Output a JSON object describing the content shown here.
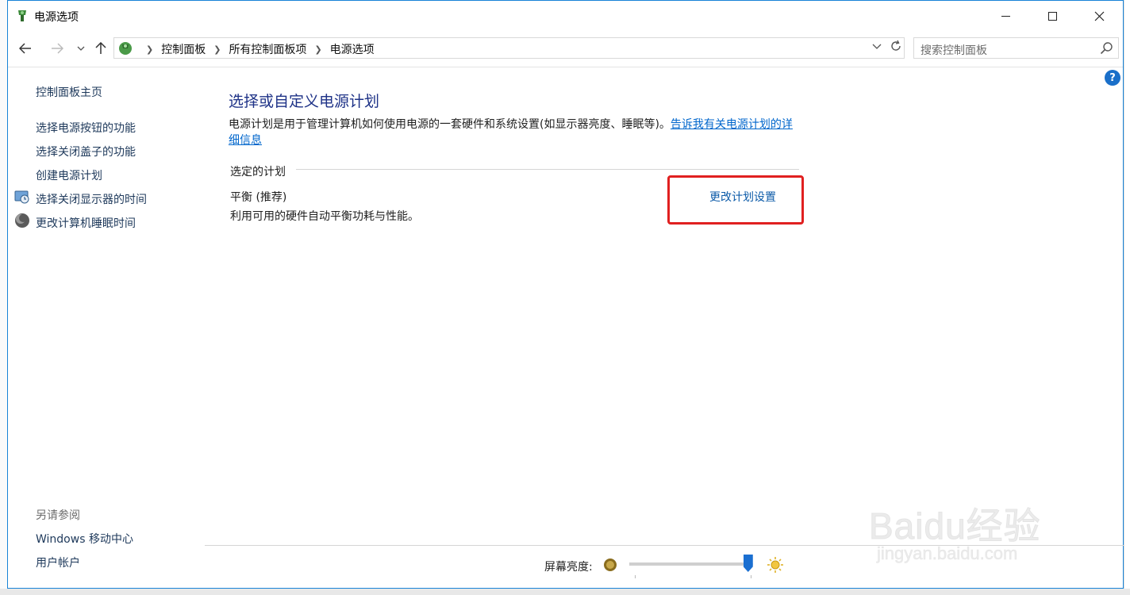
{
  "window": {
    "title": "电源选项"
  },
  "address": {
    "crumbs": [
      "控制面板",
      "所有控制面板项",
      "电源选项"
    ],
    "search_placeholder": "搜索控制面板"
  },
  "sidebar": {
    "home": "控制面板主页",
    "items": [
      {
        "label": "选择电源按钮的功能"
      },
      {
        "label": "选择关闭盖子的功能"
      },
      {
        "label": "创建电源计划"
      },
      {
        "label": "选择关闭显示器的时间",
        "icon": "display-power-icon"
      },
      {
        "label": "更改计算机睡眠时间",
        "icon": "sleep-moon-icon"
      }
    ],
    "see_also_title": "另请参阅",
    "see_also": [
      {
        "label": "Windows 移动中心"
      },
      {
        "label": "用户帐户"
      }
    ]
  },
  "main": {
    "title": "选择或自定义电源计划",
    "description": "电源计划是用于管理计算机如何使用电源的一套硬件和系统设置(如显示器亮度、睡眠等)。",
    "learn_more_link": "告诉我有关电源计划的详细信息",
    "section_label": "选定的计划",
    "plan_name": "平衡 (推荐)",
    "plan_description": "利用可用的硬件自动平衡功耗与性能。",
    "change_plan_link": "更改计划设置"
  },
  "brightness": {
    "label": "屏幕亮度:",
    "value_percent": 96
  },
  "watermark": {
    "brand": "Baidu经验",
    "url": "jingyan.baidu.com"
  },
  "colors": {
    "accent_border": "#1883d7",
    "link": "#1e395b",
    "title": "#1e3287",
    "highlight_box": "#e02020",
    "slider_thumb": "#1a6fd1"
  }
}
